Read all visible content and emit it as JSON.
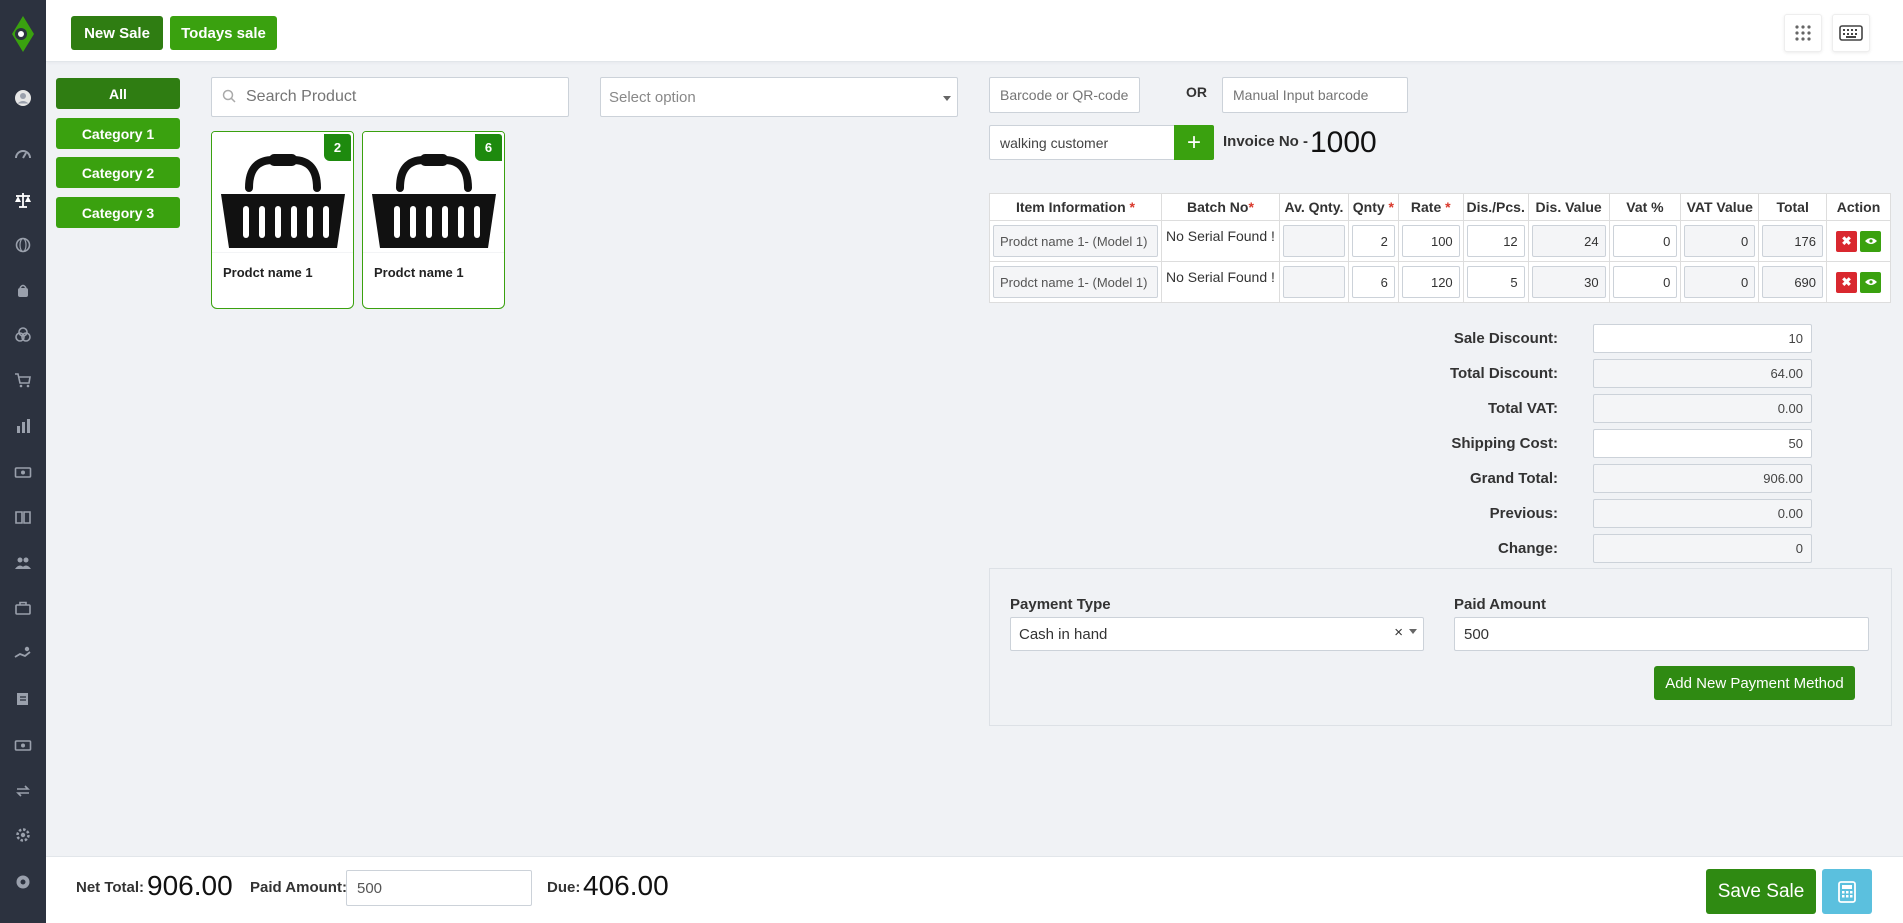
{
  "colors": {
    "brand_dark": "#2f7d12",
    "brand_green": "#3aa10f",
    "danger": "#d9282f",
    "info": "#5bc0de",
    "sidebar": "#2c323f"
  },
  "sidebar": {
    "icons": [
      "avatar-icon",
      "dashboard-icon",
      "scale-icon",
      "globe-icon",
      "bag-icon",
      "coins-icon",
      "cart-icon",
      "bar-chart-icon",
      "money-icon",
      "book-icon",
      "users-icon",
      "briefcase-icon",
      "hand-money-icon",
      "ledger-icon",
      "cash-icon",
      "exchange-icon",
      "gear-icon",
      "support-icon"
    ]
  },
  "topbar": {
    "new_sale": "New Sale",
    "todays_sale": "Todays sale"
  },
  "categories": {
    "all": "All",
    "items": [
      "Category 1",
      "Category 2",
      "Category 3"
    ]
  },
  "search": {
    "placeholder": "Search Product"
  },
  "select_option": {
    "placeholder": "Select option"
  },
  "products": [
    {
      "name": "Prodct name 1",
      "count": "2"
    },
    {
      "name": "Prodct name 1",
      "count": "6"
    }
  ],
  "barcode": {
    "placeholder": "Barcode or QR-code scan",
    "or": "OR",
    "manual_placeholder": "Manual Input barcode"
  },
  "customer": {
    "value": "walking customer",
    "add": "+"
  },
  "invoice": {
    "label": "Invoice No -",
    "number": "1000"
  },
  "table": {
    "headers": [
      "Item Information",
      "Batch No",
      "Av. Qnty.",
      "Qnty",
      "Rate",
      "Dis./Pcs.",
      "Dis. Value",
      "Vat %",
      "VAT Value",
      "Total",
      "Action"
    ],
    "required_mark": "*",
    "rows": [
      {
        "item": "Prodct name 1- (Model 1)",
        "batch": "No Serial Found !",
        "av_qty": "",
        "qty": "2",
        "rate": "100",
        "dis_pcs": "12",
        "dis_value": "24",
        "vat_pct": "0",
        "vat_value": "0",
        "total": "176"
      },
      {
        "item": "Prodct name 1- (Model 1)",
        "batch": "No Serial Found !",
        "av_qty": "",
        "qty": "6",
        "rate": "120",
        "dis_pcs": "5",
        "dis_value": "30",
        "vat_pct": "0",
        "vat_value": "0",
        "total": "690"
      }
    ]
  },
  "totals": {
    "sale_discount": {
      "label": "Sale Discount:",
      "value": "10"
    },
    "total_discount": {
      "label": "Total Discount:",
      "value": "64.00"
    },
    "total_vat": {
      "label": "Total VAT:",
      "value": "0.00"
    },
    "shipping_cost": {
      "label": "Shipping Cost:",
      "value": "50"
    },
    "grand_total": {
      "label": "Grand Total:",
      "value": "906.00"
    },
    "previous": {
      "label": "Previous:",
      "value": "0.00"
    },
    "change": {
      "label": "Change:",
      "value": "0"
    }
  },
  "payment": {
    "type_label": "Payment Type",
    "type_value": "Cash in hand",
    "clear": "×",
    "amount_label": "Paid Amount",
    "amount_value": "500",
    "add_method": "Add New Payment Method"
  },
  "footer": {
    "net_total_label": "Net Total:",
    "net_total": "906.00",
    "paid_label": "Paid Amount:",
    "paid_value": "500",
    "due_label": "Due:",
    "due": "406.00",
    "save": "Save Sale"
  }
}
